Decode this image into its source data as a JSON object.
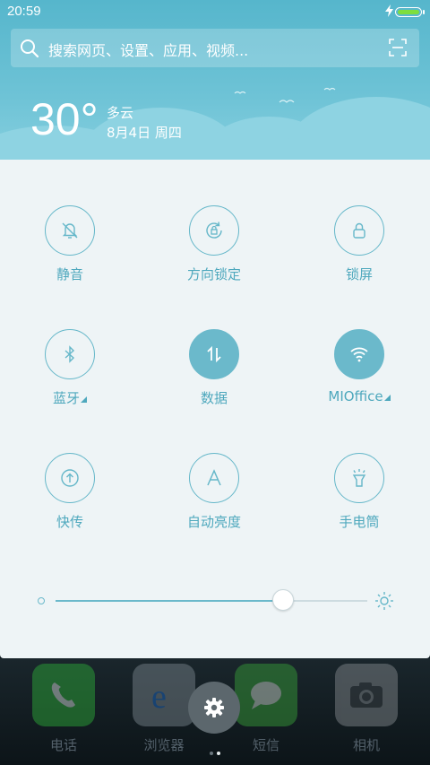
{
  "status_bar": {
    "time": "20:59"
  },
  "search": {
    "placeholder": "搜索网页、设置、应用、视频..."
  },
  "weather": {
    "temperature": "30°",
    "condition": "多云",
    "date": "8月4日 周四"
  },
  "tiles": [
    {
      "label": "静音",
      "icon": "bell-off-icon",
      "active": false
    },
    {
      "label": "方向锁定",
      "icon": "rotation-lock-icon",
      "active": false
    },
    {
      "label": "锁屏",
      "icon": "lock-icon",
      "active": false
    },
    {
      "label": "蓝牙",
      "icon": "bluetooth-icon",
      "active": false
    },
    {
      "label": "数据",
      "icon": "mobile-data-icon",
      "active": true
    },
    {
      "label": "MIOffice",
      "icon": "wifi-icon",
      "active": true
    },
    {
      "label": "快传",
      "icon": "share-upload-icon",
      "active": false
    },
    {
      "label": "自动亮度",
      "icon": "auto-brightness-icon",
      "active": false
    },
    {
      "label": "手电筒",
      "icon": "flashlight-icon",
      "active": false
    }
  ],
  "brightness": {
    "level": 0.73
  },
  "dock": [
    {
      "label": "电话",
      "icon": "phone-app-icon"
    },
    {
      "label": "浏览器",
      "icon": "browser-app-icon"
    },
    {
      "label": "短信",
      "icon": "messages-app-icon"
    },
    {
      "label": "相机",
      "icon": "camera-app-icon"
    }
  ],
  "colors": {
    "accent": "#6bb9cb",
    "label": "#4ea8bd",
    "panel": "#eef4f6",
    "sky": "#56b6cc"
  }
}
